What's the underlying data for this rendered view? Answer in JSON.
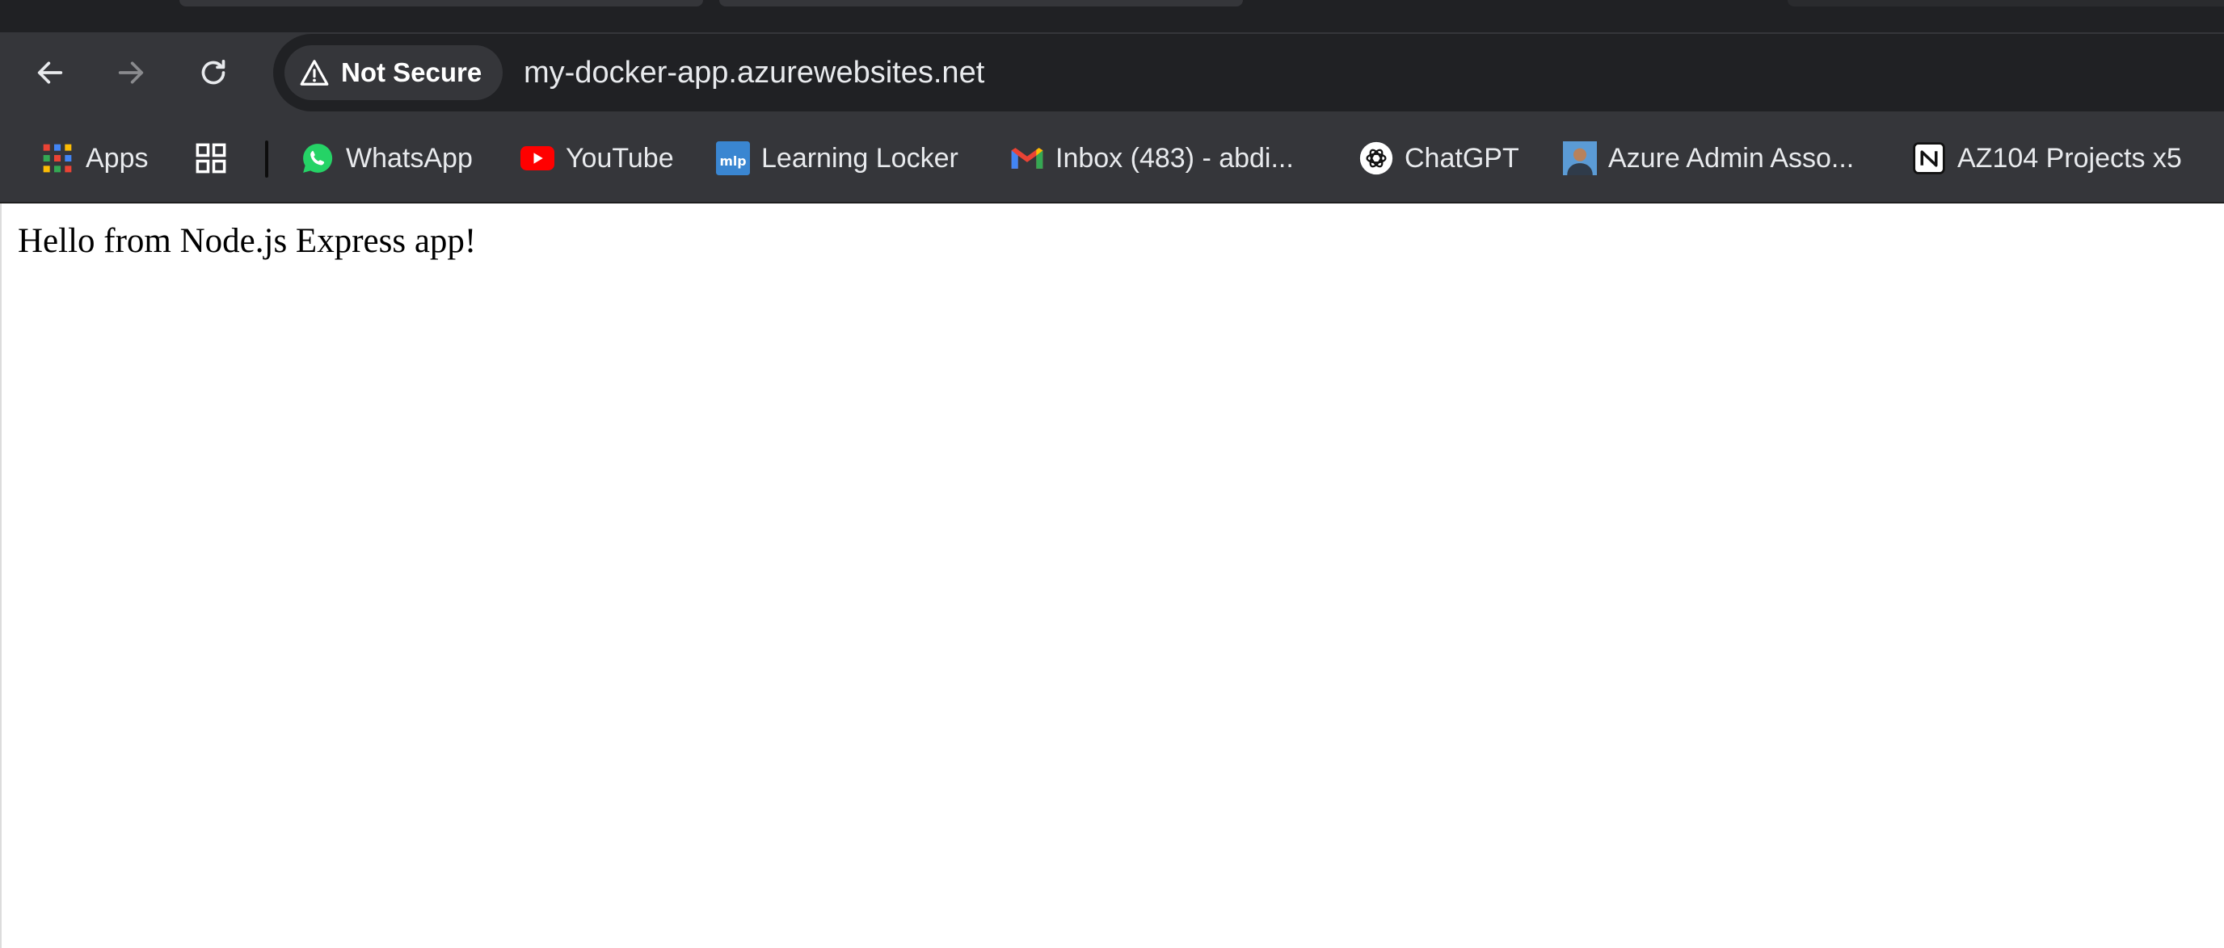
{
  "browser": {
    "toolbar": {
      "back_icon": "arrow-left-icon",
      "forward_icon": "arrow-right-icon",
      "reload_icon": "reload-icon"
    },
    "omnibox": {
      "security_label": "Not Secure",
      "security_icon": "warning-triangle-icon",
      "url": "my-docker-app.azurewebsites.net"
    },
    "bookmarks": [
      {
        "label": "Apps",
        "icon": "apps-grid-icon"
      },
      {
        "label": "",
        "icon": "tab-groups-icon"
      },
      {
        "label": "WhatsApp",
        "icon": "whatsapp-icon"
      },
      {
        "label": "YouTube",
        "icon": "youtube-icon"
      },
      {
        "label": "Learning Locker",
        "icon": "learning-locker-icon"
      },
      {
        "label": "Inbox (483) - abdi...",
        "icon": "gmail-icon"
      },
      {
        "label": "ChatGPT",
        "icon": "chatgpt-icon"
      },
      {
        "label": "Azure Admin Asso...",
        "icon": "avatar-icon"
      },
      {
        "label": "AZ104 Projects x5",
        "icon": "notion-icon"
      }
    ],
    "colors": {
      "chrome_bg": "#35363a",
      "omnibox_bg": "#202124",
      "text": "#e8eaed"
    }
  },
  "page": {
    "body_text": "Hello from Node.js Express app!"
  }
}
